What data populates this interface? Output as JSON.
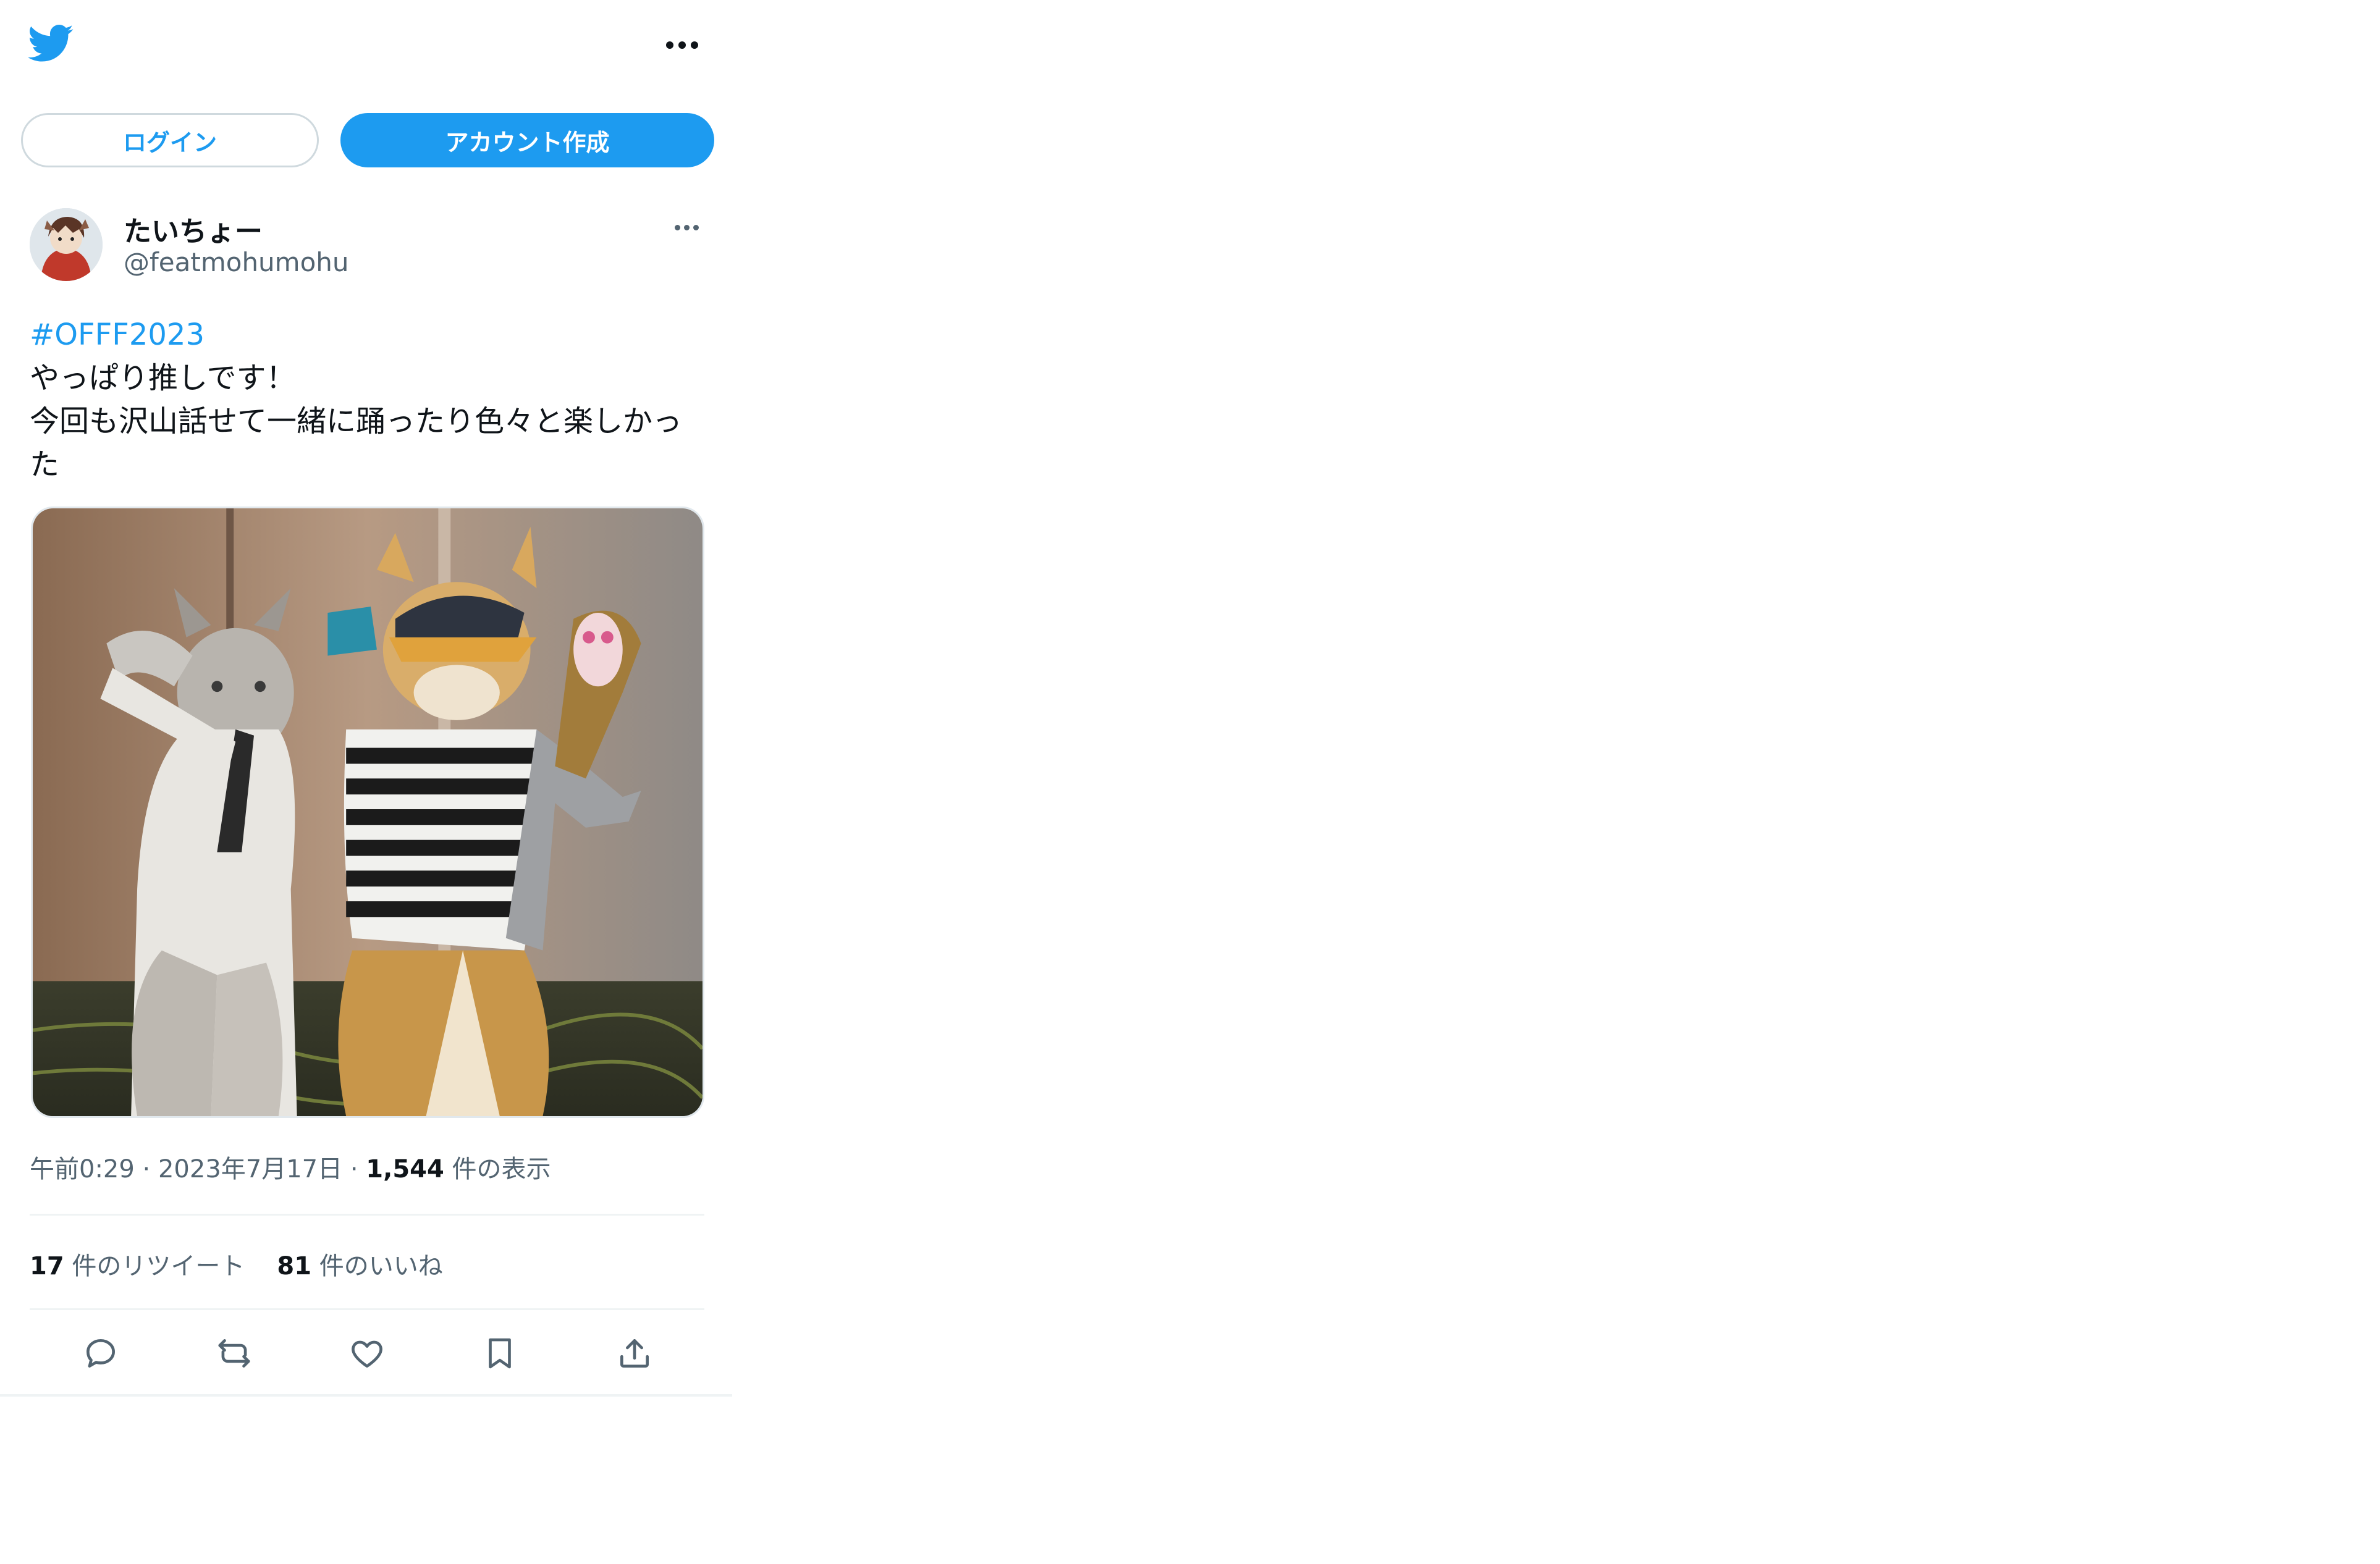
{
  "header": {
    "logo_icon": "twitter-bird-icon",
    "menu_icon": "more-horizontal-icon"
  },
  "auth": {
    "login_label": "ログイン",
    "signup_label": "アカウント作成"
  },
  "tweet": {
    "author": {
      "display_name": "たいちょー",
      "handle": "@featmohumohu",
      "avatar_icon": "avatar-image"
    },
    "text": {
      "hashtag": "#OFFF2023",
      "lines": [
        "やっぱり推しです！",
        "今回も沢山話せて一緒に踊ったり色々と楽しかっ",
        "た"
      ]
    },
    "meta": {
      "time": "午前0:29",
      "separator": "·",
      "date": "2023年7月17日",
      "views_count": "1,544",
      "views_label": "件の表示"
    },
    "stats": {
      "retweets_count": "17",
      "retweets_label": "件のリツイート",
      "likes_count": "81",
      "likes_label": "件のいいね"
    },
    "actions": [
      {
        "name": "reply",
        "icon": "reply-icon"
      },
      {
        "name": "retweet",
        "icon": "retweet-icon"
      },
      {
        "name": "like",
        "icon": "heart-icon"
      },
      {
        "name": "bookmark",
        "icon": "bookmark-icon"
      },
      {
        "name": "share",
        "icon": "share-icon"
      }
    ]
  },
  "colors": {
    "brand": "#1d9bf0",
    "text": "#0f1419",
    "secondary": "#536471",
    "border": "#eff3f4"
  }
}
